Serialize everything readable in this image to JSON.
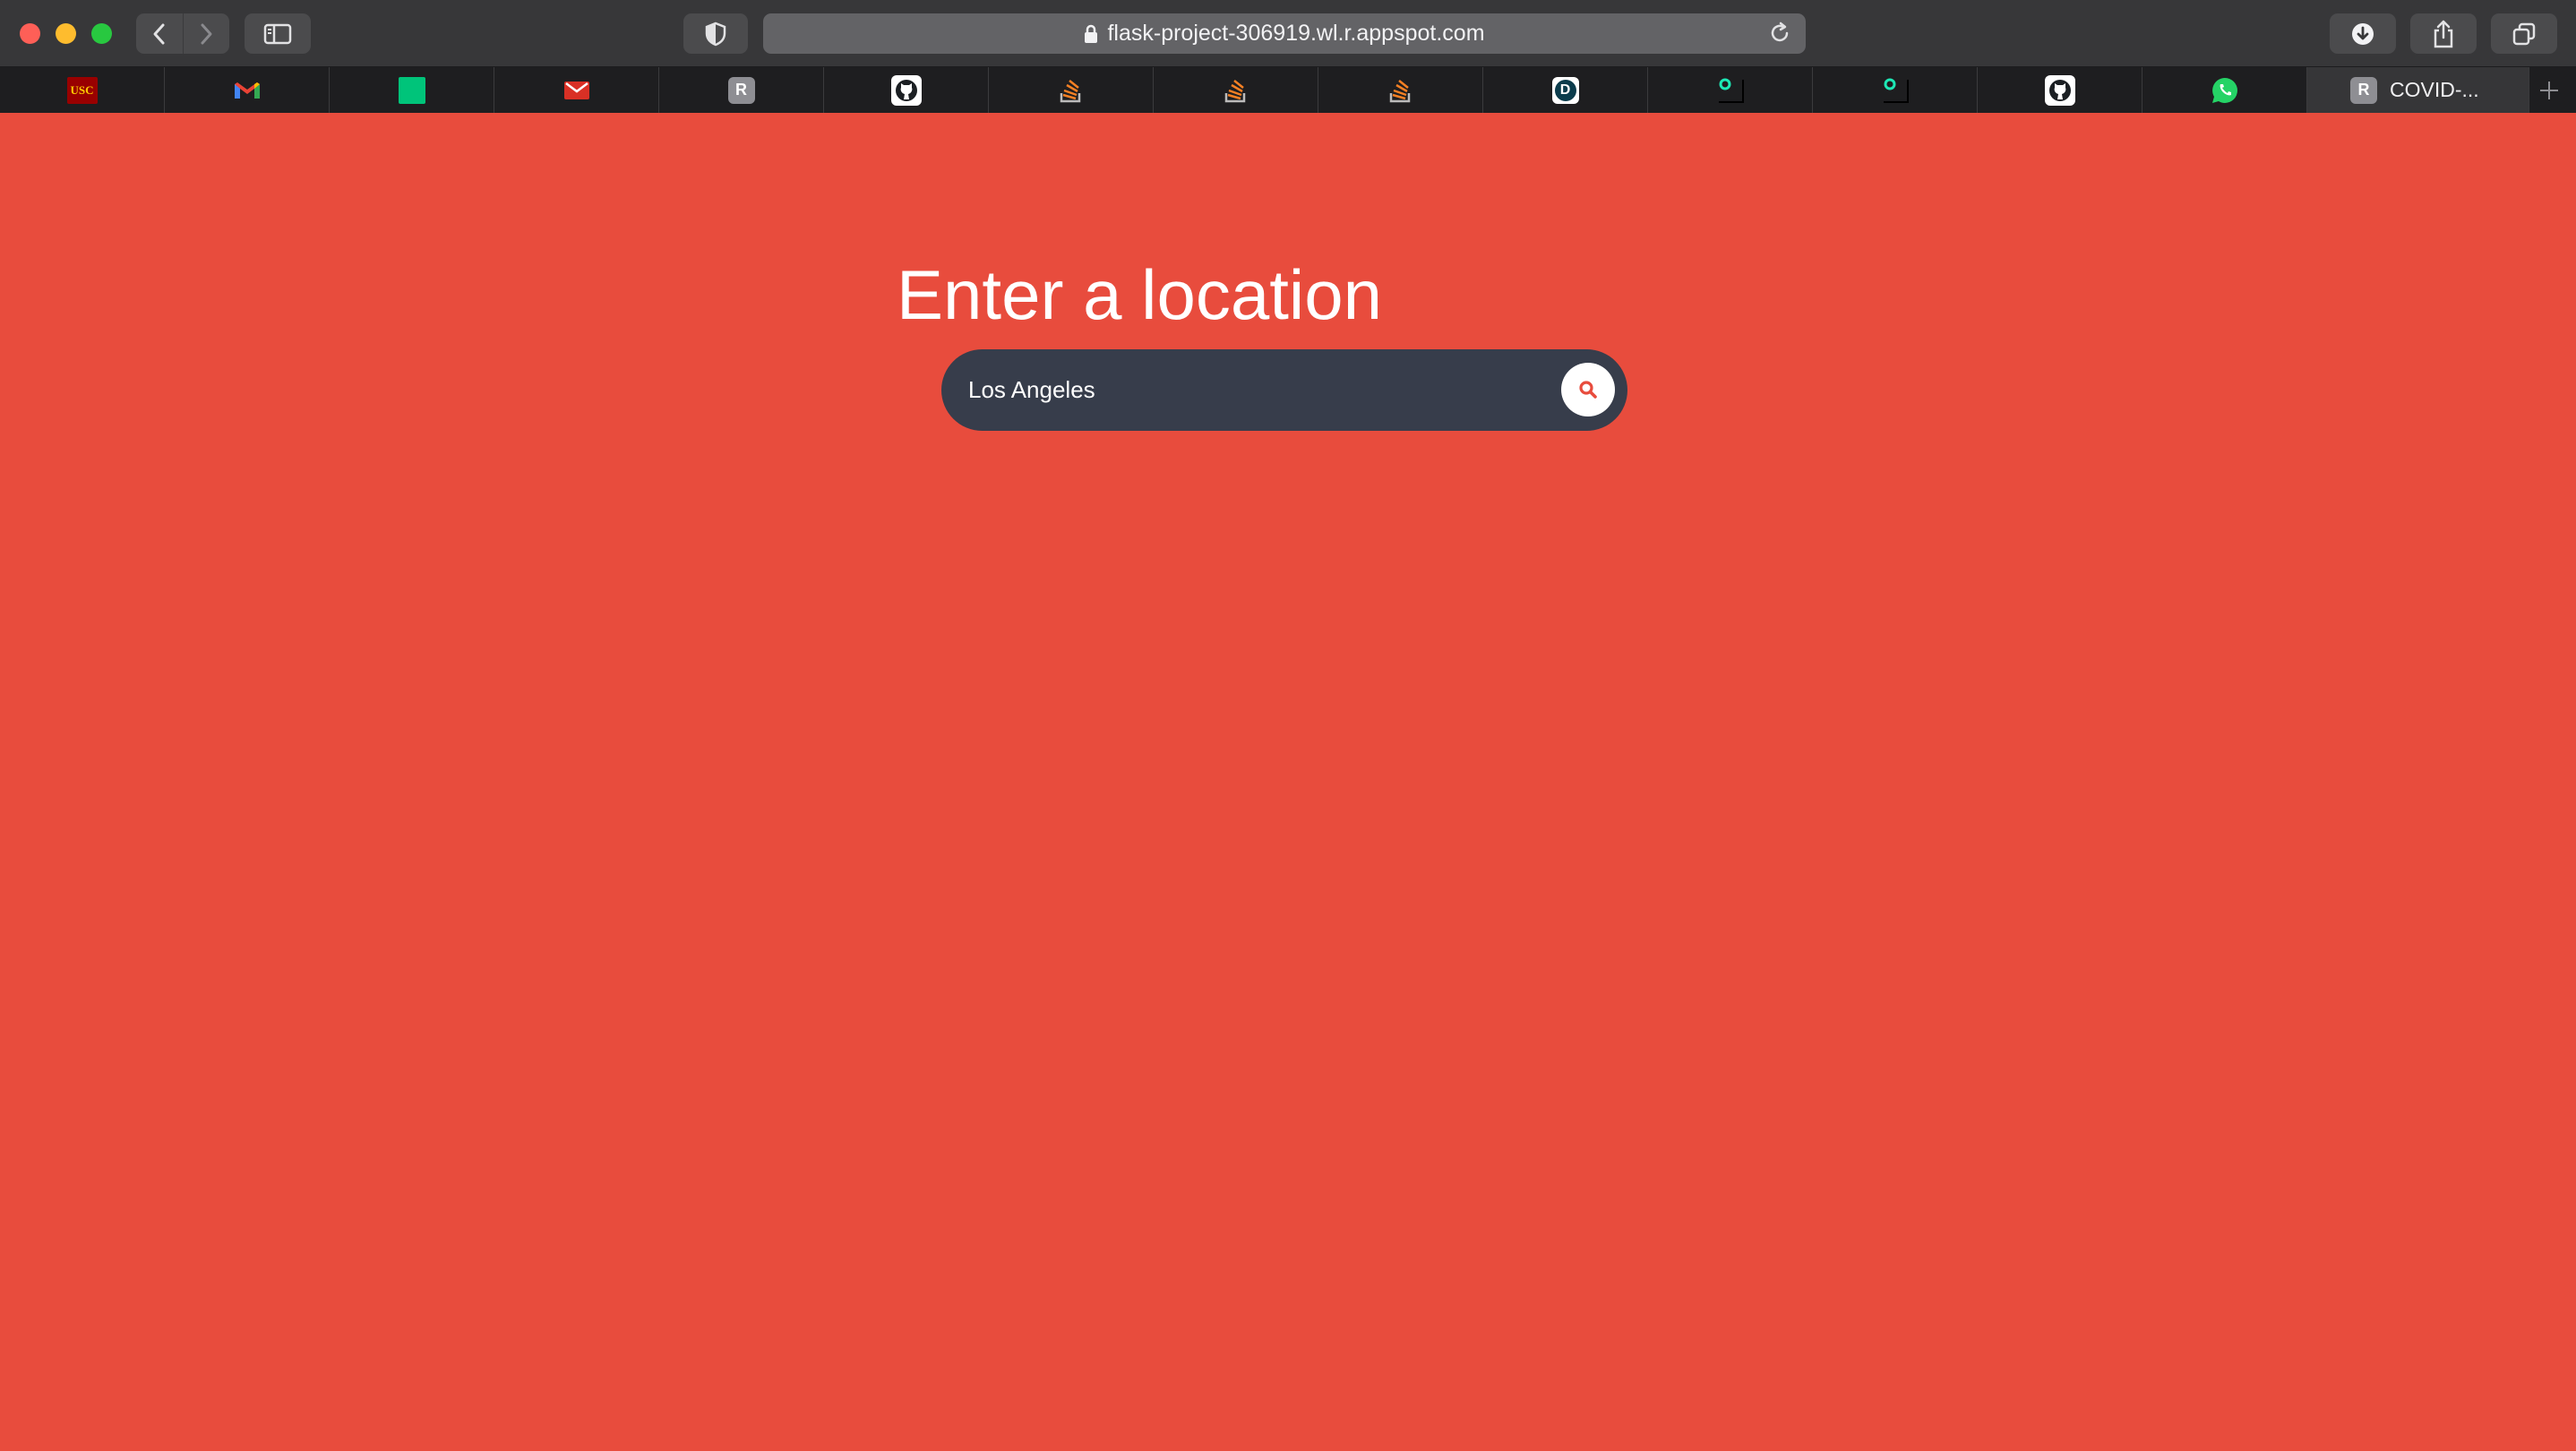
{
  "browser": {
    "url": "flask-project-306919.wl.r.appspot.com",
    "tabs": [
      {
        "icon": "usc-icon",
        "label": "USC"
      },
      {
        "icon": "gmail-icon",
        "label": "M"
      },
      {
        "icon": "green-square-icon",
        "label": ""
      },
      {
        "icon": "mail-envelope-icon",
        "label": ""
      },
      {
        "icon": "r-icon",
        "label": "R"
      },
      {
        "icon": "github-icon",
        "label": ""
      },
      {
        "icon": "stackoverflow-icon",
        "label": ""
      },
      {
        "icon": "stackoverflow-icon",
        "label": ""
      },
      {
        "icon": "stackoverflow-icon",
        "label": ""
      },
      {
        "icon": "d-icon",
        "label": "D"
      },
      {
        "icon": "o-icon",
        "label": ""
      },
      {
        "icon": "o-icon",
        "label": ""
      },
      {
        "icon": "github-icon",
        "label": ""
      },
      {
        "icon": "whatsapp-icon",
        "label": ""
      }
    ],
    "active_tab": {
      "icon": "r-icon",
      "icon_label": "R",
      "title": "COVID-..."
    }
  },
  "page": {
    "background_color": "#e84c3d",
    "heading": "Enter a location",
    "search": {
      "value": "Los Angeles",
      "button_icon": "search-icon",
      "pill_color": "#373d4b",
      "icon_color": "#e84c3d"
    }
  }
}
